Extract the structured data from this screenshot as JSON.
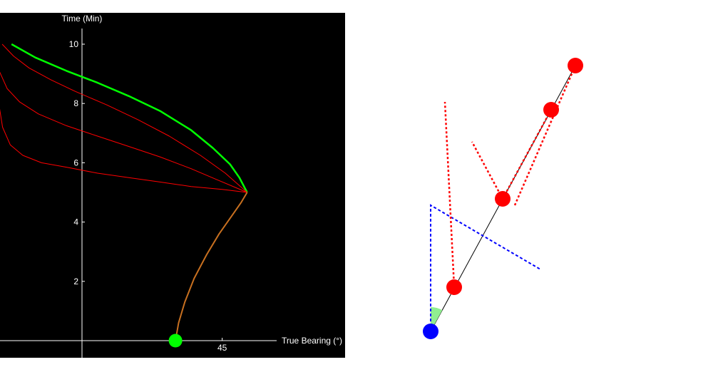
{
  "chart_data": {
    "type": "line",
    "xlabel": "True Bearing (°)",
    "ylabel": "Time (Min)",
    "x_ticks": [
      45
    ],
    "y_ticks": [
      2,
      4,
      6,
      8,
      10
    ],
    "x_range": [
      -27,
      65
    ],
    "y_range": [
      -0.5,
      10.8
    ],
    "colors": {
      "main_curve": "#00ff00",
      "alt_curves": "#ff0000",
      "past_track": "#c87020",
      "marker": "#00ff00",
      "axes": "#ffffff",
      "background": "#000000"
    },
    "series": [
      {
        "x": [
          -22.6,
          -15,
          -5,
          5,
          15,
          25,
          35,
          42,
          47.5,
          50.5,
          53
        ],
        "y": [
          10.0,
          9.55,
          9.1,
          8.7,
          8.25,
          7.75,
          7.1,
          6.5,
          5.95,
          5.5,
          5.0
        ]
      },
      {
        "x": [
          -25.6,
          -22,
          -17,
          -10,
          -2,
          8,
          18,
          28,
          38,
          46,
          53
        ],
        "y": [
          10.0,
          9.6,
          9.2,
          8.8,
          8.4,
          7.95,
          7.45,
          6.9,
          6.25,
          5.65,
          5.0
        ]
      },
      {
        "x": [
          -27,
          -24,
          -20,
          -14,
          -5,
          5,
          15,
          25,
          35,
          44,
          53
        ],
        "y": [
          9.2,
          8.5,
          8.05,
          7.65,
          7.25,
          6.9,
          6.55,
          6.2,
          5.8,
          5.4,
          5.0
        ]
      },
      {
        "x": [
          -27,
          -25.5,
          -23,
          -19,
          -13,
          -5,
          5,
          15,
          25,
          35,
          45,
          53
        ],
        "y": [
          8.2,
          7.2,
          6.6,
          6.25,
          6.0,
          5.85,
          5.65,
          5.5,
          5.35,
          5.2,
          5.1,
          5.0
        ]
      },
      {
        "x": [
          30,
          31,
          33,
          36,
          40,
          44,
          48,
          51,
          53
        ],
        "y": [
          0,
          0.6,
          1.3,
          2.1,
          2.9,
          3.6,
          4.2,
          4.65,
          5.0
        ]
      }
    ],
    "marker": {
      "x": 30,
      "y": 0
    }
  },
  "geometry": {
    "colors": {
      "observer": "#0000ff",
      "target": "#ff0000",
      "reference": "#0000ff",
      "angle_fill": "#90ee90",
      "track": "#000000"
    }
  }
}
